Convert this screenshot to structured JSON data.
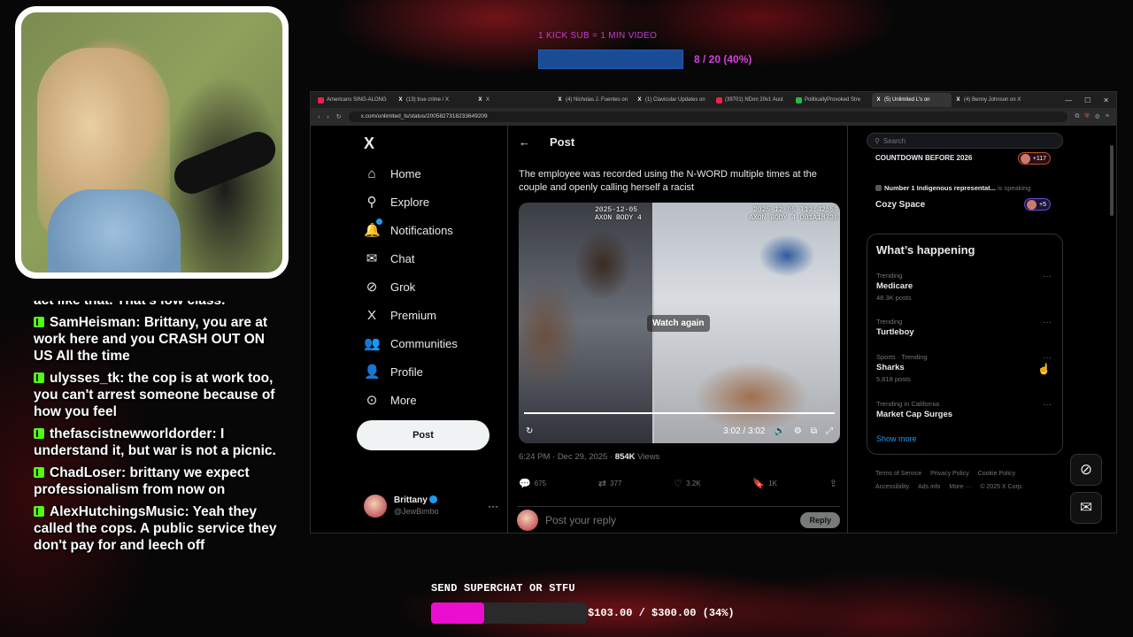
{
  "top_goal": {
    "title": "1 KICK SUB = 1 MIN VIDEO",
    "count_text": "8 / 20 (40%)",
    "progress": 0.4,
    "color": "#1a4c95"
  },
  "chat": {
    "messages": [
      {
        "user": "",
        "text": "act like that. That's low class.",
        "partial": true
      },
      {
        "user": "SamHeisman",
        "text": "Brittany, you are at work here and you CRASH OUT ON US All the time"
      },
      {
        "user": "ulysses_tk",
        "text": "the cop is at work too, you can't arrest someone because of how you feel"
      },
      {
        "user": "thefascistnewworldorder",
        "text": "I understand it, but war is not a picnic."
      },
      {
        "user": "ChadLoser",
        "text": "brittany we expect professionalism from now on"
      },
      {
        "user": "AlexHutchingsMusic",
        "text": "Yeah they called the cops. A public service they don't pay for and leech off"
      }
    ]
  },
  "browser": {
    "tabs": [
      {
        "label": "Americans SING-ALONG",
        "icon": "red"
      },
      {
        "label": "(13) true crime / X",
        "icon": "x"
      },
      {
        "label": "X",
        "icon": "x"
      },
      {
        "label": "(4) Nicholas J. Fuentes on",
        "icon": "x"
      },
      {
        "label": "(1) Clavicular Updates on",
        "icon": "x"
      },
      {
        "label": "(39701) NDon 20v1 Aust",
        "icon": "red"
      },
      {
        "label": "PoliticallyProvoked Stre",
        "icon": "green"
      },
      {
        "label": "(5) Unlimited L's on",
        "icon": "x",
        "active": true
      },
      {
        "label": "(4) Benny Johnson on X",
        "icon": "x"
      }
    ],
    "url": "x.com/unlimited_ls/status/2005827318233649209"
  },
  "nav": {
    "logo": "X",
    "items": [
      {
        "label": "Home",
        "icon": "home-icon",
        "glyph": "⌂"
      },
      {
        "label": "Explore",
        "icon": "search-icon",
        "glyph": "⚲"
      },
      {
        "label": "Notifications",
        "icon": "bell-icon",
        "glyph": "🔔"
      },
      {
        "label": "Chat",
        "icon": "mail-icon",
        "glyph": "✉"
      },
      {
        "label": "Grok",
        "icon": "grok-icon",
        "glyph": "⊘"
      },
      {
        "label": "Premium",
        "icon": "x-premium-icon",
        "glyph": "X"
      },
      {
        "label": "Communities",
        "icon": "people-icon",
        "glyph": "👥"
      },
      {
        "label": "Profile",
        "icon": "person-icon",
        "glyph": "👤"
      },
      {
        "label": "More",
        "icon": "more-circle-icon",
        "glyph": "⊙"
      }
    ],
    "post_button": "Post",
    "account": {
      "name": "Brittany",
      "handle": "@JewBimbo"
    }
  },
  "post": {
    "header": "Post",
    "text": "The employee was recorded using the N-WORD multiple times at the couple and openly calling herself a racist",
    "video": {
      "stamp_left_1": "2025-12-05",
      "stamp_left_2": "AXON BODY 4",
      "stamp_right_1": "2025-12-05 T13:42:59",
      "stamp_right_2": "AXON BODY 4 D01A18736",
      "overlay": "Watch again",
      "time": "3:02 / 3:02"
    },
    "meta": {
      "time": "6:24 PM · Dec 29, 2025 ·",
      "views_count": "854K",
      "views_label": "Views"
    },
    "actions": {
      "replies": "675",
      "reposts": "377",
      "likes": "3.2K",
      "bookmarks": "1K"
    },
    "reply_placeholder": "Post your reply",
    "reply_button": "Reply"
  },
  "sidebar": {
    "search_placeholder": "Search",
    "spaces": [
      {
        "title": "COUNTDOWN BEFORE 2026",
        "pill": "+117"
      },
      {
        "host": "Number 1 Indigenous representat...",
        "status": "is speaking",
        "title": "Cozy Space",
        "pill": "+5"
      }
    ],
    "whats_happening": {
      "title": "What’s happening",
      "trends": [
        {
          "context": "Trending",
          "name": "Medicare",
          "posts": "48.3K posts"
        },
        {
          "context": "Trending",
          "name": "Turtleboy",
          "posts": ""
        },
        {
          "context": "Sports · Trending",
          "name": "Sharks",
          "posts": "5,818 posts"
        },
        {
          "context": "Trending in California",
          "name": "Market Cap Surges",
          "posts": ""
        }
      ],
      "show_more": "Show more"
    },
    "footer": [
      "Terms of Service",
      "Privacy Policy",
      "Cookie Policy",
      "Accessibility",
      "Ads info",
      "More ···",
      "© 2025 X Corp."
    ]
  },
  "superchat": {
    "title": "SEND SUPERCHAT OR STFU",
    "amount": "$103.00 / $300.00 (34%)",
    "progress": 0.34,
    "color": "#ea0fd0"
  }
}
